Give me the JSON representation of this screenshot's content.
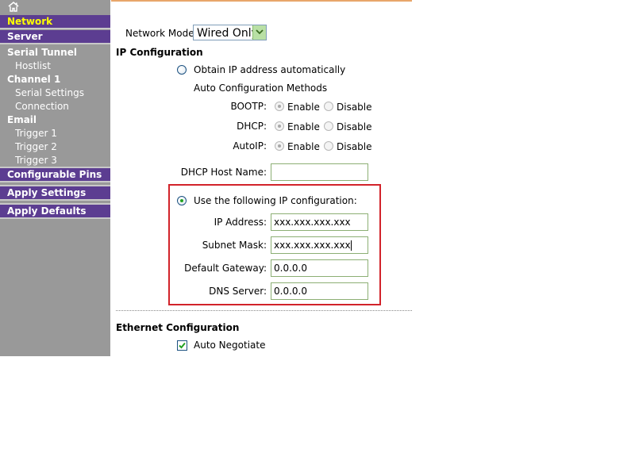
{
  "sidebar": {
    "home_icon": "home-icon",
    "items": [
      {
        "label": "Network"
      },
      {
        "label": "Server"
      },
      {
        "label": "Serial Tunnel"
      },
      {
        "label": "Hostlist"
      },
      {
        "label": "Channel 1"
      },
      {
        "label": "Serial Settings"
      },
      {
        "label": "Connection"
      },
      {
        "label": "Email"
      },
      {
        "label": "Trigger 1"
      },
      {
        "label": "Trigger 2"
      },
      {
        "label": "Trigger 3"
      },
      {
        "label": "Configurable Pins"
      },
      {
        "label": "Apply Settings"
      },
      {
        "label": "Apply Defaults"
      }
    ]
  },
  "network_mode": {
    "label": "Network Mode:",
    "value": "Wired Only"
  },
  "ip_config": {
    "heading": "IP Configuration",
    "obtain_auto": "Obtain IP address automatically",
    "auto_methods": "Auto Configuration Methods",
    "methods": [
      {
        "label": "BOOTP:",
        "enable": "Enable",
        "disable": "Disable"
      },
      {
        "label": "DHCP:",
        "enable": "Enable",
        "disable": "Disable"
      },
      {
        "label": "AutoIP:",
        "enable": "Enable",
        "disable": "Disable"
      }
    ],
    "dhcp_host_name": {
      "label": "DHCP Host Name:",
      "value": ""
    },
    "use_following": "Use the following IP configuration:",
    "fields": [
      {
        "label": "IP Address:",
        "value": "xxx.xxx.xxx.xxx"
      },
      {
        "label": "Subnet Mask:",
        "value": "xxx.xxx.xxx.xxx"
      },
      {
        "label": "Default Gateway:",
        "value": "0.0.0.0"
      },
      {
        "label": "DNS Server:",
        "value": "0.0.0.0"
      }
    ]
  },
  "ethernet": {
    "heading": "Ethernet Configuration",
    "auto_negotiate": "Auto Negotiate",
    "auto_negotiate_checked": true
  },
  "colors": {
    "sidebar_bg": "#999999",
    "nav_bar": "#5c3d91",
    "active_nav": "#ffff00",
    "highlight_box": "#d2232a",
    "top_rule": "#e8a66a"
  }
}
